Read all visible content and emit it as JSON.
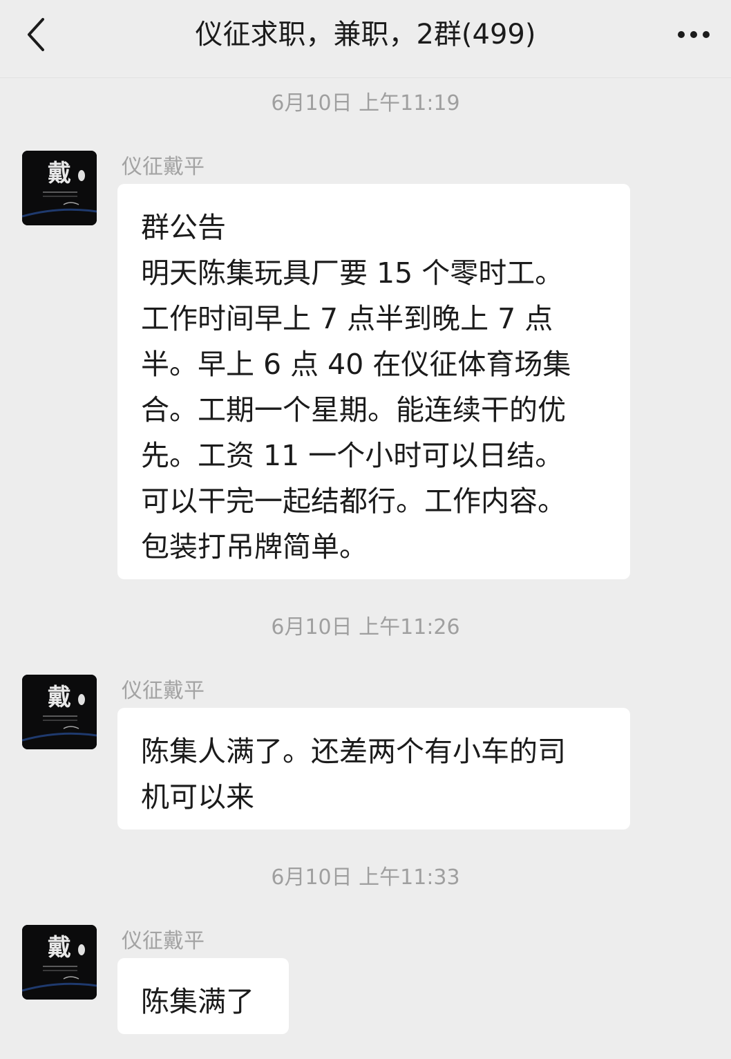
{
  "header": {
    "title": "仪征求职，兼职，2群(499)",
    "back_icon": "chevron-left-icon",
    "more_icon": "more-horizontal-icon"
  },
  "colors": {
    "background": "#ededed",
    "bubble": "#ffffff",
    "timestamp_text": "#9f9f9f",
    "sender_text": "#a3a3a3"
  },
  "avatar": {
    "seal_text": "戴"
  },
  "messages": [
    {
      "timestamp": "6月10日 上午11:19",
      "sender": "仪征戴平",
      "lines": [
        "群公告",
        "明天陈集玩具厂要 15 个零时工。",
        "工作时间早上 7 点半到晚上 7 点",
        "半。早上 6 点 40 在仪征体育场集",
        "合。工期一个星期。能连续干的优",
        "先。工资 11 一个小时可以日结。",
        "可以干完一起结都行。工作内容。",
        "包装打吊牌简单。"
      ]
    },
    {
      "timestamp": "6月10日 上午11:26",
      "sender": "仪征戴平",
      "lines": [
        "陈集人满了。还差两个有小车的司",
        "机可以来"
      ]
    },
    {
      "timestamp": "6月10日 上午11:33",
      "sender": "仪征戴平",
      "lines": [
        "陈集满了"
      ]
    }
  ]
}
